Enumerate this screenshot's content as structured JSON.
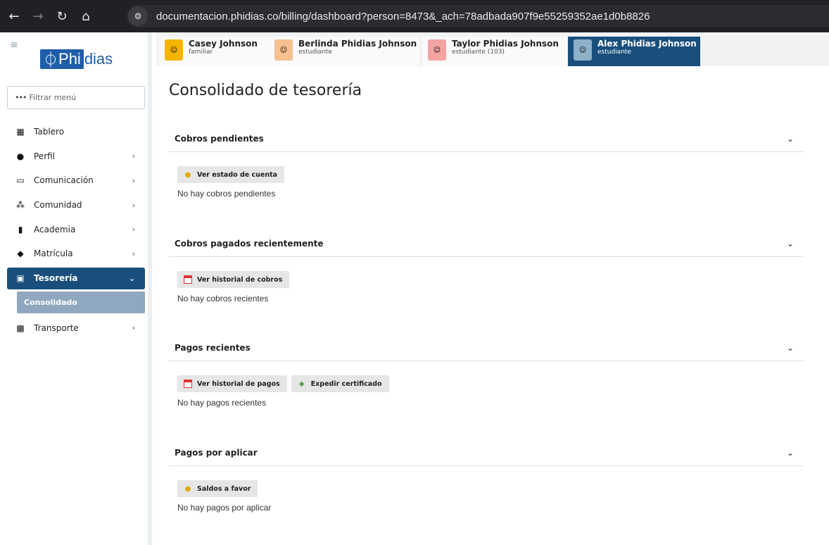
{
  "browser": {
    "url": "documentacion.phidias.co/billing/dashboard?person=8473&_ach=78adbada907f9e55259352ae1d0b8826"
  },
  "sidebar": {
    "logo_mark": "Phi",
    "logo_rest": "dias",
    "filter_placeholder": "Filtrar menú",
    "items": [
      {
        "label": "Tablero",
        "icon": "dashboard-icon",
        "has_children": false
      },
      {
        "label": "Perfil",
        "icon": "user-icon",
        "has_children": true
      },
      {
        "label": "Comunicación",
        "icon": "inbox-icon",
        "has_children": true
      },
      {
        "label": "Comunidad",
        "icon": "people-icon",
        "has_children": true
      },
      {
        "label": "Academia",
        "icon": "books-icon",
        "has_children": true
      },
      {
        "label": "Matrícula",
        "icon": "graduation-cap-icon",
        "has_children": true
      },
      {
        "label": "Tesorería",
        "icon": "money-icon",
        "has_children": true,
        "expanded": true
      },
      {
        "label": "Transporte",
        "icon": "bus-icon",
        "has_children": true
      }
    ],
    "sub_item": "Consolidado"
  },
  "people": [
    {
      "name": "Casey Johnson",
      "role": "familiar",
      "active": false
    },
    {
      "name": "Berlinda Phidias Johnson",
      "role": "estudiante",
      "active": false
    },
    {
      "name": "Taylor Phidias Johnson",
      "role": "estudiante (103)",
      "active": false
    },
    {
      "name": "Alex Phidias Johnson",
      "role": "estudiante",
      "active": true
    }
  ],
  "main": {
    "title": "Consolidado de tesorería",
    "sections": [
      {
        "title": "Cobros pendientes",
        "buttons": [
          {
            "label": "Ver estado de cuenta",
            "icon": "coins-icon"
          }
        ],
        "empty": "No hay cobros pendientes"
      },
      {
        "title": "Cobros pagados recientemente",
        "buttons": [
          {
            "label": "Ver historial de cobros",
            "icon": "calendar-icon"
          }
        ],
        "empty": "No hay cobros recientes"
      },
      {
        "title": "Pagos recientes",
        "buttons": [
          {
            "label": "Ver historial de pagos",
            "icon": "calendar-icon"
          },
          {
            "label": "Expedir certificado",
            "icon": "certificate-icon"
          }
        ],
        "empty": "No hay pagos recientes"
      },
      {
        "title": "Pagos por aplicar",
        "buttons": [
          {
            "label": "Saldos a favor",
            "icon": "coins-icon"
          }
        ],
        "empty": "No hay pagos por aplicar"
      }
    ]
  }
}
